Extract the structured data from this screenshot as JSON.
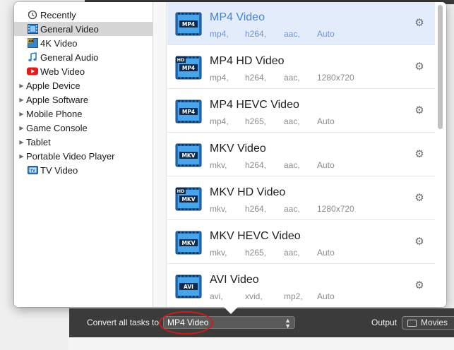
{
  "sidebar": {
    "items": [
      {
        "label": "Recently",
        "icon": "clock-icon",
        "expandable": false
      },
      {
        "label": "General Video",
        "icon": "film-icon",
        "expandable": false,
        "selected": true
      },
      {
        "label": "4K Video",
        "icon": "4k-icon",
        "expandable": false
      },
      {
        "label": "General Audio",
        "icon": "music-note-icon",
        "expandable": false
      },
      {
        "label": "Web Video",
        "icon": "youtube-icon",
        "expandable": false
      },
      {
        "label": "Apple Device",
        "expandable": true
      },
      {
        "label": "Apple Software",
        "expandable": true
      },
      {
        "label": "Mobile Phone",
        "expandable": true
      },
      {
        "label": "Game Console",
        "expandable": true
      },
      {
        "label": "Tablet",
        "expandable": true
      },
      {
        "label": "Portable Video Player",
        "expandable": true
      },
      {
        "label": "TV Video",
        "icon": "tv-icon",
        "expandable": false
      }
    ]
  },
  "formats": [
    {
      "title": "MP4 Video",
      "badge": "MP4",
      "hd": false,
      "specs": [
        "mp4,",
        "h264,",
        "aac,",
        "Auto"
      ],
      "selected": true
    },
    {
      "title": "MP4 HD Video",
      "badge": "MP4",
      "hd": true,
      "specs": [
        "mp4,",
        "h264,",
        "aac,",
        "1280x720"
      ]
    },
    {
      "title": "MP4 HEVC Video",
      "badge": "MP4",
      "hd": false,
      "specs": [
        "mp4,",
        "h265,",
        "aac,",
        "Auto"
      ]
    },
    {
      "title": "MKV Video",
      "badge": "MKV",
      "hd": false,
      "specs": [
        "mkv,",
        "h264,",
        "aac,",
        "Auto"
      ]
    },
    {
      "title": "MKV HD Video",
      "badge": "MKV",
      "hd": true,
      "specs": [
        "mkv,",
        "h264,",
        "aac,",
        "1280x720"
      ]
    },
    {
      "title": "MKV HEVC Video",
      "badge": "MKV",
      "hd": false,
      "specs": [
        "mkv,",
        "h265,",
        "aac,",
        "Auto"
      ]
    },
    {
      "title": "AVI Video",
      "badge": "AVI",
      "hd": false,
      "specs": [
        "avi,",
        "xvid,",
        "mp2,",
        "Auto"
      ]
    }
  ],
  "bottom": {
    "convert_label": "Convert all tasks to",
    "selected_format": "MP4 Video",
    "output_label": "Output",
    "output_value": "Movies"
  },
  "colors": {
    "selection_blue": "#e3ecfb",
    "selected_title": "#4a7fd6",
    "highlight_circle": "#d11a1a",
    "film_icon": "#2a7dc9"
  }
}
